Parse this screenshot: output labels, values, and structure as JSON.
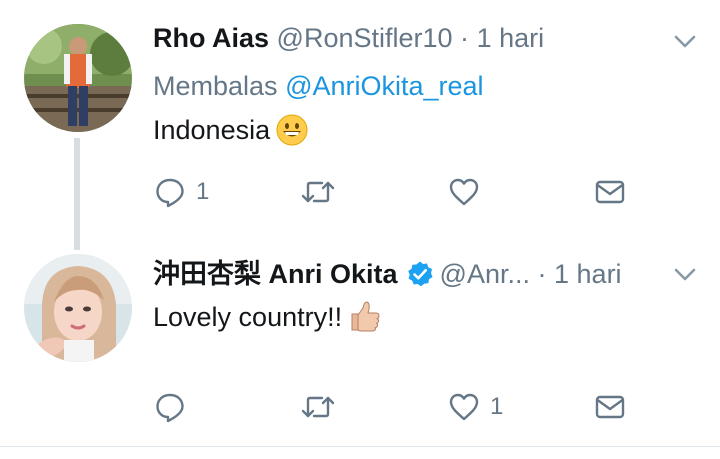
{
  "tweets": [
    {
      "name": "Rho Aias",
      "handle": "@RonStifler10",
      "separator": "·",
      "time": "1 hari",
      "replying_prefix": "Membalas",
      "replying_to": "@AnriOkita_real",
      "text": "Indonesia",
      "emoji": "grinning-face",
      "verified": false,
      "actions": {
        "reply_count": "1",
        "retweet_count": "",
        "like_count": ""
      }
    },
    {
      "name": "沖田杏梨 Anri Okita",
      "handle": "@Anr...",
      "separator": "·",
      "time": "1 hari",
      "text": "Lovely country!!",
      "emoji": "thumbs-up",
      "verified": true,
      "actions": {
        "reply_count": "",
        "retweet_count": "",
        "like_count": "1"
      }
    }
  ],
  "colors": {
    "text": "#14171a",
    "secondary": "#657786",
    "link": "#1b95e0",
    "verified": "#1da1f2",
    "thread_line": "#d9dde1"
  }
}
